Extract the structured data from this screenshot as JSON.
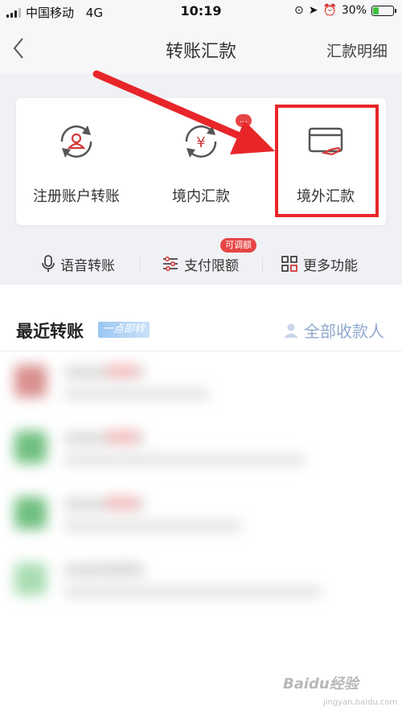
{
  "status_bar": {
    "carrier": "中国移动",
    "network": "4G",
    "time": "10:19",
    "battery_percent_text": "30%",
    "battery_level": 0.3
  },
  "nav": {
    "title": "转账汇款",
    "right_link": "汇款明细"
  },
  "services": [
    {
      "label": "注册账户转账",
      "icon": "refresh-user-icon"
    },
    {
      "label": "境内汇款",
      "icon": "yen-cycle-icon",
      "badge": "…"
    },
    {
      "label": "境外汇款",
      "icon": "card-hand-icon"
    }
  ],
  "quick": [
    {
      "label": "语音转账",
      "icon": "microphone-icon"
    },
    {
      "label": "支付限额",
      "icon": "sliders-icon",
      "badge": "可调额"
    },
    {
      "label": "更多功能",
      "icon": "grid-icon"
    }
  ],
  "recent": {
    "title": "最近转账",
    "tag": "一点即转",
    "all_payees": "全部收款人"
  },
  "colors": {
    "accent_red": "#e8262a",
    "badge_red": "#e64545",
    "link_blue": "#8fa8cf"
  },
  "watermark": {
    "text": "Baidu经验",
    "sub": "jingyan.baidu.com"
  }
}
